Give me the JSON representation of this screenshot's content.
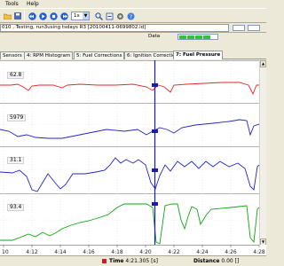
{
  "menu": {
    "tools": "Tools",
    "help": "Help"
  },
  "toolbar": {
    "speed": "1x"
  },
  "file_info": {
    "text": "010 , Testing, run3using tsdays R3 [20100411-0699802.ld]"
  },
  "data_label": "Data",
  "tabs": [
    {
      "label": "Sensors"
    },
    {
      "label": "4: RPM Histogram"
    },
    {
      "label": "5: Fuel Corrections"
    },
    {
      "label": "6: Ignition Corrections"
    },
    {
      "label": "7: Fuel Pressure"
    }
  ],
  "channels": [
    {
      "value": "62.8",
      "color": "#e8262a"
    },
    {
      "value": "5979",
      "color": "#2424c8"
    },
    {
      "value": "31.1",
      "color": "#2424c8"
    },
    {
      "value": "93.4",
      "color": "#0ea50e"
    }
  ],
  "axis": {
    "ticks": [
      "10",
      "4:12",
      "4:14",
      "4:16",
      "4:18",
      "4:20",
      "4:22",
      "4:24",
      "4:26",
      "4:28"
    ]
  },
  "status": {
    "time_label": "Time",
    "time_value": "4:21.305",
    "time_unit": "[s]",
    "distance_label": "Distance",
    "distance_value": "0.00",
    "distance_unit": "[]",
    "marker_color": "#c81e1e"
  }
}
